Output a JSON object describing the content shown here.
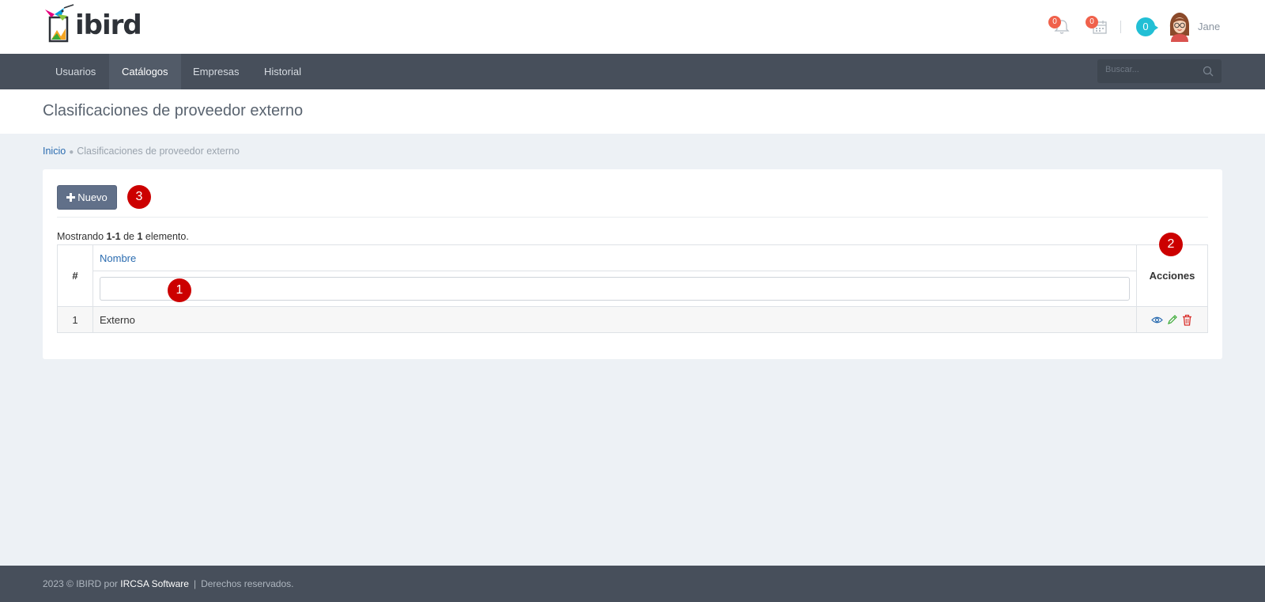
{
  "brand": {
    "name": "ibird"
  },
  "header": {
    "notifications_count": "0",
    "calendar_count": "0",
    "chat_count": "0",
    "username": "Jane"
  },
  "nav": {
    "items": [
      {
        "label": "Usuarios"
      },
      {
        "label": "Catálogos"
      },
      {
        "label": "Empresas"
      },
      {
        "label": "Historial"
      }
    ],
    "active": "Catálogos",
    "search_placeholder": "Buscar..."
  },
  "page": {
    "title": "Clasificaciones de proveedor externo"
  },
  "breadcrumb": {
    "home": "Inicio",
    "current": "Clasificaciones de proveedor externo"
  },
  "toolbar": {
    "new_label": "Nuevo"
  },
  "summary": {
    "prefix": "Mostrando ",
    "range": "1-1",
    "middle": " de ",
    "total": "1",
    "suffix": " elemento."
  },
  "table": {
    "columns": {
      "num": "#",
      "name": "Nombre",
      "actions": "Acciones"
    },
    "filter_value": "",
    "rows": [
      {
        "num": "1",
        "name": "Externo"
      }
    ]
  },
  "markers": [
    "1",
    "2",
    "3"
  ],
  "footer": {
    "prefix": "2023 © IBIRD por ",
    "company": "IRCSA Software",
    "sep": "|",
    "rights": "Derechos reservados."
  },
  "colors": {
    "nav_bg": "#474f5b",
    "accent": "#2b6cb0",
    "badge": "#f0614b",
    "chat": "#22bfd5",
    "marker": "#cc0000",
    "button": "#617089"
  }
}
